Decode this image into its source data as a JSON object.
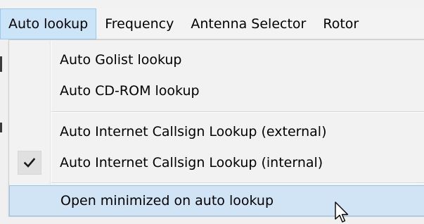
{
  "menubar": {
    "items": [
      {
        "label": "Auto lookup",
        "active": true
      },
      {
        "label": "Frequency"
      },
      {
        "label": "Antenna Selector"
      },
      {
        "label": "Rotor"
      }
    ]
  },
  "dropdown": {
    "items": [
      {
        "label": "Auto Golist lookup",
        "checked": false
      },
      {
        "label": "Auto CD-ROM lookup",
        "checked": false
      },
      {
        "label": "Auto Internet Callsign Lookup (external)",
        "checked": false
      },
      {
        "label": "Auto Internet Callsign Lookup (internal)",
        "checked": true
      },
      {
        "label": "Open minimized on auto lookup",
        "checked": false,
        "hovered": true
      }
    ],
    "check_glyph": "✔",
    "colors": {
      "hover_bg": "#d0e4f6",
      "hover_border": "#9ac5ea",
      "active_menu_bg": "#cce4f7"
    }
  },
  "icons": {
    "check": "checkmark-icon",
    "cursor": "mouse-pointer-icon"
  }
}
